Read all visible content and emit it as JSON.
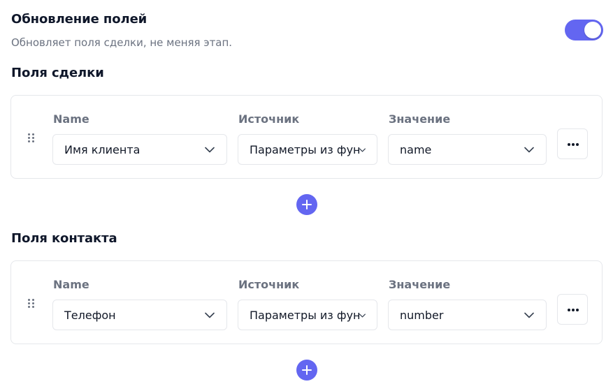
{
  "header": {
    "title": "Обновление полей",
    "subtitle": "Обновляет поля сделки, не меняя этап.",
    "toggle_on": true
  },
  "sections": [
    {
      "title": "Поля сделки",
      "columns": {
        "name": "Name",
        "source": "Источник",
        "value": "Значение"
      },
      "row": {
        "name": "Имя клиента",
        "source": "Параметры из функции",
        "value": "name"
      }
    },
    {
      "title": "Поля контакта",
      "columns": {
        "name": "Name",
        "source": "Источник",
        "value": "Значение"
      },
      "row": {
        "name": "Телефон",
        "source": "Параметры из функции",
        "value": "number"
      }
    }
  ],
  "icons": {
    "drag": "drag-handle-icon",
    "more": "more-horizontal-icon",
    "add": "plus-icon",
    "chevron": "chevron-down-icon"
  },
  "colors": {
    "accent": "#6366f1",
    "label_gray": "#6b7280",
    "border": "#e5e7eb"
  }
}
